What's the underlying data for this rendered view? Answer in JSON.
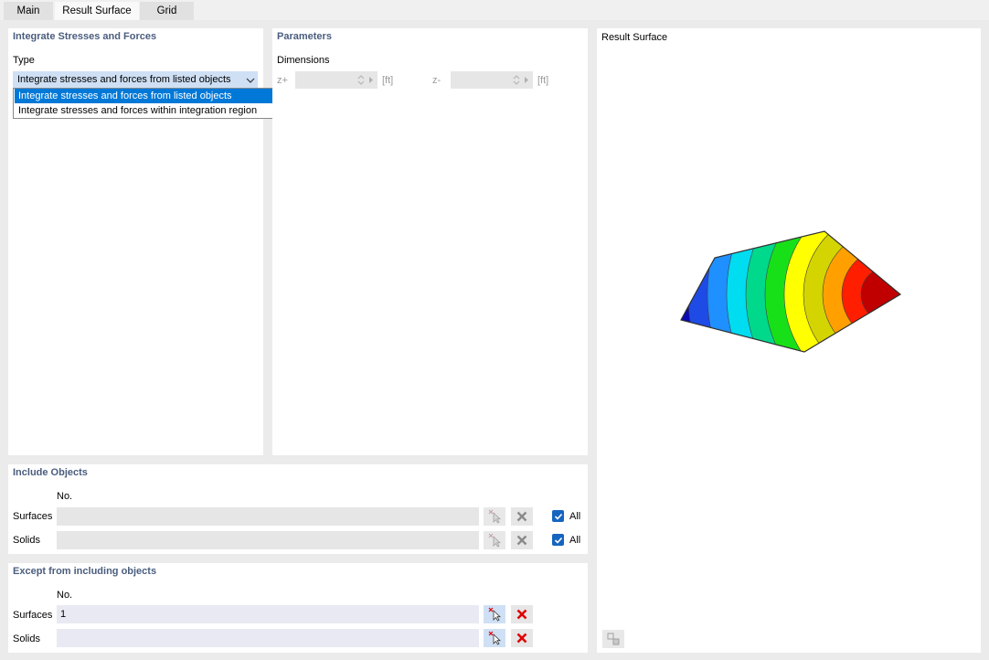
{
  "tabs": [
    "Main",
    "Result Surface",
    "Grid"
  ],
  "integrate": {
    "title": "Integrate Stresses and Forces",
    "type_label": "Type",
    "selected": "Integrate stresses and forces from listed objects",
    "options": [
      "Integrate stresses and forces from listed objects",
      "Integrate stresses and forces within integration region"
    ]
  },
  "parameters": {
    "title": "Parameters",
    "dimensions_label": "Dimensions",
    "zplus_label": "z+",
    "zminus_label": "z-",
    "unit": "[ft]"
  },
  "include": {
    "title": "Include Objects",
    "no_header": "No.",
    "surfaces_label": "Surfaces",
    "solids_label": "Solids",
    "surfaces_value": "",
    "solids_value": "",
    "all_label": "All",
    "surfaces_all": true,
    "solids_all": true
  },
  "except": {
    "title": "Except from including objects",
    "no_header": "No.",
    "surfaces_label": "Surfaces",
    "solids_label": "Solids",
    "surfaces_value": "1",
    "solids_value": ""
  },
  "preview": {
    "title": "Result Surface",
    "contour_colors": [
      "#0a0ab4",
      "#1e4ae6",
      "#1e90ff",
      "#00dcf0",
      "#00d88c",
      "#18e018",
      "#ffff00",
      "#d4d400",
      "#ffa000",
      "#ff1e00",
      "#c00000"
    ]
  },
  "icons": {
    "select": "pick-pointer-icon",
    "clear": "red-x-icon",
    "chevron": "chevron-down-icon",
    "preview_options": "view-options-icon"
  }
}
